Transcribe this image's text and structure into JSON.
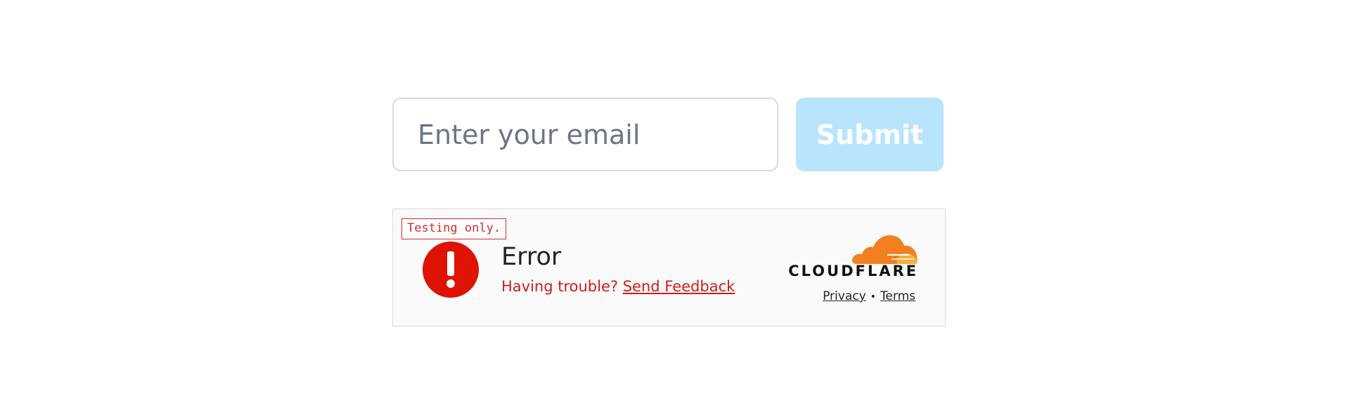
{
  "form": {
    "email_placeholder": "Enter your email",
    "email_value": "",
    "submit_label": "Submit"
  },
  "widget": {
    "test_badge": "Testing only.",
    "status_title": "Error",
    "trouble_text": "Having trouble?",
    "feedback_link": "Send Feedback",
    "brand": "CLOUDFLARE",
    "privacy_link": "Privacy",
    "separator": "•",
    "terms_link": "Terms",
    "icons": {
      "status": "error-exclamation-icon",
      "brand": "cloudflare-cloud-logo"
    }
  },
  "colors": {
    "submit_bg": "#b8e4fd",
    "error_red": "#d11c1c",
    "cloudflare_orange": "#f38020",
    "cloudflare_light_orange": "#faad3f"
  }
}
